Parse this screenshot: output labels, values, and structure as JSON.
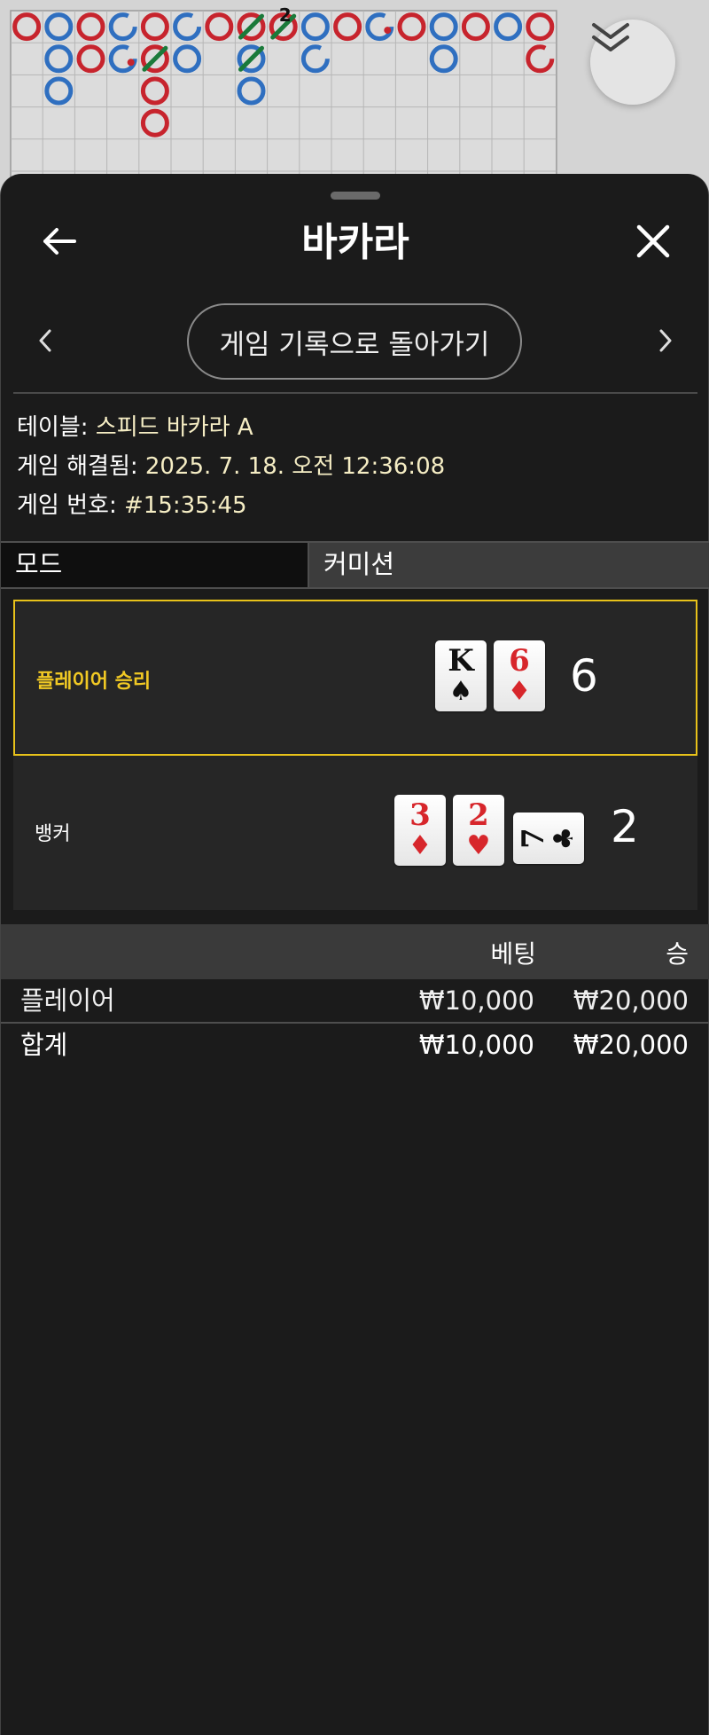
{
  "roadmap": {
    "bead_plate": [
      [
        {
          "c": "red"
        },
        {
          "c": "blue"
        },
        {
          "c": "red"
        },
        {
          "c": "blue",
          "gap": true
        },
        {
          "c": "red"
        },
        {
          "c": "blue",
          "gap": true
        },
        {
          "c": "red"
        },
        {
          "c": "red",
          "tie": true
        },
        {
          "c": "red",
          "tie": true,
          "count": "2"
        },
        {
          "c": "blue"
        },
        {
          "c": "red"
        },
        {
          "c": "blue",
          "gap": true,
          "dot": true
        },
        {
          "c": "red"
        },
        {
          "c": "blue"
        },
        {
          "c": "red"
        },
        {
          "c": "blue"
        },
        {
          "c": "red"
        }
      ],
      [
        null,
        {
          "c": "blue"
        },
        {
          "c": "red"
        },
        {
          "c": "blue",
          "gap": true,
          "dot": true
        },
        {
          "c": "red",
          "tie": true
        },
        {
          "c": "blue"
        },
        null,
        {
          "c": "blue",
          "tie": true
        },
        null,
        {
          "c": "blue",
          "gap": true
        },
        null,
        null,
        null,
        {
          "c": "blue"
        },
        null,
        null,
        {
          "c": "red",
          "gap": true
        }
      ],
      [
        null,
        {
          "c": "blue"
        },
        null,
        null,
        {
          "c": "red"
        },
        null,
        null,
        {
          "c": "blue"
        },
        null,
        null,
        null,
        null,
        null,
        null,
        null,
        null,
        null
      ],
      [
        null,
        null,
        null,
        null,
        {
          "c": "red"
        },
        null,
        null,
        null,
        null,
        null,
        null,
        null,
        null,
        null,
        null,
        null,
        null
      ]
    ],
    "colors": {
      "red": "#c7242d",
      "blue": "#2f6fc0",
      "tie": "#1a7a3a"
    }
  },
  "collapse_button": {
    "icon": "double-chevron-down-icon"
  },
  "header": {
    "title": "바카라",
    "back_icon": "arrow-left-icon",
    "close_icon": "close-icon"
  },
  "nav": {
    "back_to_history_label": "게임 기록으로 돌아가기",
    "prev_icon": "chevron-left-icon",
    "next_icon": "chevron-right-icon"
  },
  "info": {
    "table_label": "테이블: ",
    "table_value": "스피드 바카라 A",
    "resolved_label": "게임 해결됨: ",
    "resolved_value": "2025. 7. 18. 오전 12:36:08",
    "number_label": "게임 번호: ",
    "number_value": "#15:35:45"
  },
  "tabs": {
    "mode": "모드",
    "commission": "커미션"
  },
  "result": {
    "player": {
      "label": "플레이어 승리",
      "score": "6",
      "cards": [
        {
          "rank": "K",
          "suit": "♠",
          "color": "black"
        },
        {
          "rank": "6",
          "suit": "♦",
          "color": "red"
        }
      ]
    },
    "banker": {
      "label": "뱅커",
      "score": "2",
      "cards": [
        {
          "rank": "3",
          "suit": "♦",
          "color": "red"
        },
        {
          "rank": "2",
          "suit": "♥",
          "color": "red"
        },
        {
          "rank": "7",
          "suit": "♣",
          "color": "black",
          "sideways": true
        }
      ]
    },
    "win_highlight_color": "#e8c21a"
  },
  "bets": {
    "headers": {
      "bet": "베팅",
      "win": "승"
    },
    "rows": [
      {
        "name": "플레이어",
        "bet": "₩10,000",
        "win": "₩20,000"
      }
    ],
    "total": {
      "name": "합계",
      "bet": "₩10,000",
      "win": "₩20,000"
    }
  }
}
